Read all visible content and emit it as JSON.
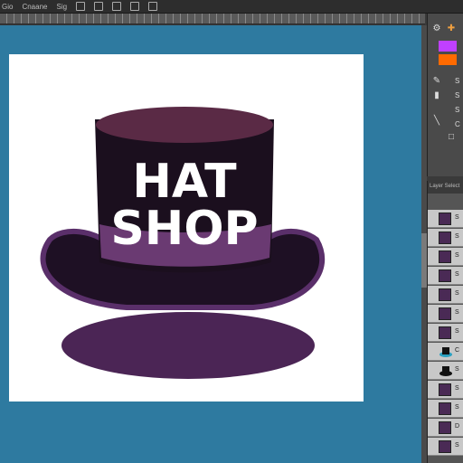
{
  "menu": {
    "items": [
      "Gio",
      "Cnaane",
      "Sig"
    ]
  },
  "artwork": {
    "line1": "HAT",
    "line2": "SHOP",
    "colors": {
      "crown": "#1b0f1e",
      "crown_top": "#5a2a45",
      "band": "#6a3a72",
      "brim": "#1e1024",
      "brim_rim": "#5a2f6a",
      "shadow": "#4b2555",
      "canvas_bg": "#2e7aa0"
    }
  },
  "tools": {
    "labels": [
      "S",
      "S",
      "S",
      "C"
    ]
  },
  "layers": {
    "header": "Layer Select",
    "rows": [
      {
        "label": "S"
      },
      {
        "label": "S"
      },
      {
        "label": "S"
      },
      {
        "label": "S"
      },
      {
        "label": "S"
      },
      {
        "label": "S"
      },
      {
        "label": "S"
      },
      {
        "label": "C"
      },
      {
        "label": "S"
      },
      {
        "label": "S"
      },
      {
        "label": "S"
      },
      {
        "label": "D"
      },
      {
        "label": "S"
      },
      {
        "label": "S"
      }
    ]
  }
}
